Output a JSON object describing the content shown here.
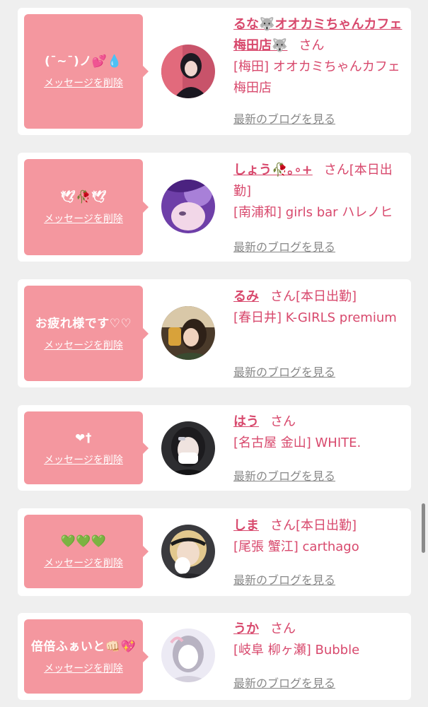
{
  "delete_label": "メッセージを削除",
  "blog_label": "最新のブログを見る",
  "san_label": "さん",
  "cards": [
    {
      "message": "(ˉ~ˉ)ノ💕💧",
      "name": "るな🐺オオカミちゃんカフェ梅田店🐺",
      "status": "",
      "shop": "[梅田] オオカミちゃんカフェ梅田店"
    },
    {
      "message": "🕊🥀🕊",
      "name": "しょう🥀｡∘+",
      "status": "[本日出勤]",
      "shop": "[南浦和] girls bar ハレノヒ"
    },
    {
      "message": "お疲れ様です♡♡",
      "name": "るみ",
      "status": "[本日出勤]",
      "shop": "[春日井] K-GIRLS premium"
    },
    {
      "message": "❤†",
      "name": "はう",
      "status": "",
      "shop": "[名古屋 金山] WHITE."
    },
    {
      "message": "💚💚💚",
      "name": "しま",
      "status": "[本日出勤]",
      "shop": "[尾張 蟹江] carthago"
    },
    {
      "message": "倍倍ふぁいと👊🏻💖",
      "name": "うか",
      "status": "",
      "shop": "[岐阜 柳ヶ瀬] Bubble"
    }
  ],
  "colors": {
    "bubble": "#f4979f",
    "name": "#d8496d",
    "blog_link": "#888888",
    "background": "#efefef"
  }
}
